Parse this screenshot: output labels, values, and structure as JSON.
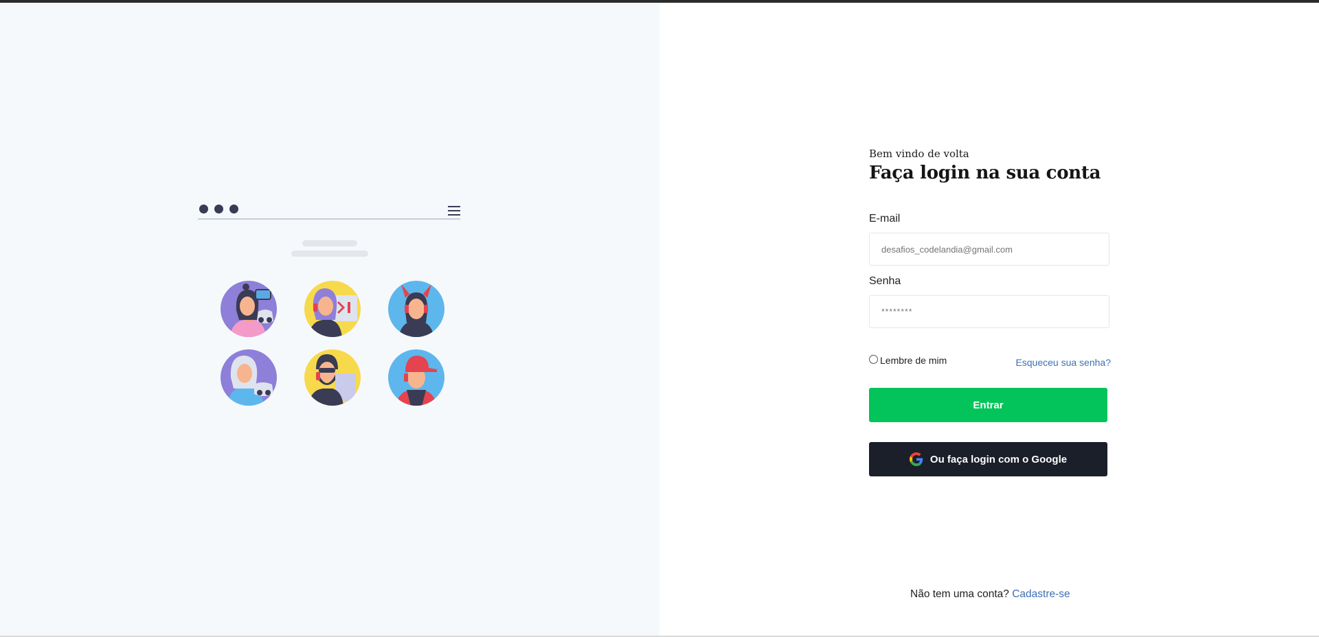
{
  "colors": {
    "accent_green": "#03c45a",
    "google_button": "#1b1f2a",
    "link_blue": "#3d6fb5",
    "left_panel_bg": "#f5f9fc"
  },
  "illustration": {
    "menu_icon": "hamburger-menu-icon",
    "avatars": [
      "avatar-woman-vr-headset",
      "avatar-person-code-screen",
      "avatar-woman-devil-horns",
      "avatar-gray-hair-gamepad",
      "avatar-man-sunglasses-beard",
      "avatar-man-red-cap"
    ]
  },
  "login": {
    "welcome": "Bem vindo de volta",
    "heading": "Faça login na sua conta",
    "email_label": "E-mail",
    "email_placeholder": "desafios_codelandia@gmail.com",
    "password_label": "Senha",
    "password_value": "********",
    "remember_label": "Lembre de mim",
    "forgot_label": "Esqueceu sua senha?",
    "submit_label": "Entrar",
    "google_label": "Ou faça login com o Google",
    "google_icon": "google-g-icon"
  },
  "signup": {
    "prompt": "Não tem uma conta?",
    "link": "Cadastre-se"
  }
}
